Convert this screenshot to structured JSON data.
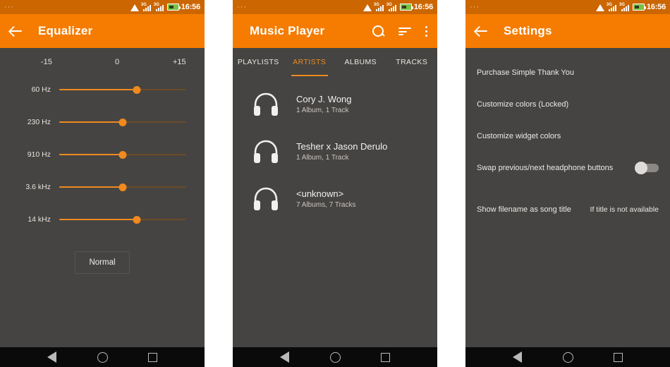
{
  "status_bar": {
    "dots": "···",
    "time": "16:56",
    "network_label": "3G",
    "icons": [
      "wifi-icon",
      "signal-icon",
      "signal-icon",
      "battery-icon"
    ]
  },
  "nav_bar": {
    "back_label": "Back",
    "home_label": "Home",
    "recents_label": "Recents"
  },
  "screen_equalizer": {
    "title": "Equalizer",
    "back_icon": "arrow-back-icon",
    "scale": {
      "min": "-15",
      "mid": "0",
      "max": "+15"
    },
    "bands": [
      {
        "label": "60 Hz",
        "position_pct": 61
      },
      {
        "label": "230 Hz",
        "position_pct": 50
      },
      {
        "label": "910 Hz",
        "position_pct": 50
      },
      {
        "label": "3.6 kHz",
        "position_pct": 50
      },
      {
        "label": "14 kHz",
        "position_pct": 61
      }
    ],
    "preset_button": "Normal"
  },
  "screen_music_player": {
    "title": "Music Player",
    "actions": [
      {
        "name": "search-icon",
        "label": "Search"
      },
      {
        "name": "sort-icon",
        "label": "Sort"
      },
      {
        "name": "overflow-menu-icon",
        "label": "More options"
      }
    ],
    "tabs": [
      {
        "label": "PLAYLISTS",
        "active": false
      },
      {
        "label": "ARTISTS",
        "active": true
      },
      {
        "label": "ALBUMS",
        "active": false
      },
      {
        "label": "TRACKS",
        "active": false
      }
    ],
    "artists": [
      {
        "name": "Cory J. Wong",
        "meta": "1 Album, 1 Track"
      },
      {
        "name": "Tesher x Jason Derulo",
        "meta": "1 Album, 1 Track"
      },
      {
        "name": "<unknown>",
        "meta": "7 Albums, 7 Tracks"
      }
    ]
  },
  "screen_settings": {
    "title": "Settings",
    "back_icon": "arrow-back-icon",
    "items": [
      {
        "title": "Purchase Simple Thank You",
        "value": "",
        "control": "none"
      },
      {
        "title": "Customize colors (Locked)",
        "value": "",
        "control": "none"
      },
      {
        "title": "Customize widget colors",
        "value": "",
        "control": "none"
      },
      {
        "title": "Swap previous/next headphone buttons",
        "value": "",
        "control": "switch",
        "switch_on": false
      },
      {
        "title": "Show filename as song title",
        "value": "If title is not available",
        "control": "value"
      }
    ]
  },
  "colors": {
    "accent": "#F57C00",
    "accent_light": "#F08A1E",
    "status_bar": "#CC6600",
    "background": "#464442",
    "nav_bar": "#0a0a0a"
  }
}
